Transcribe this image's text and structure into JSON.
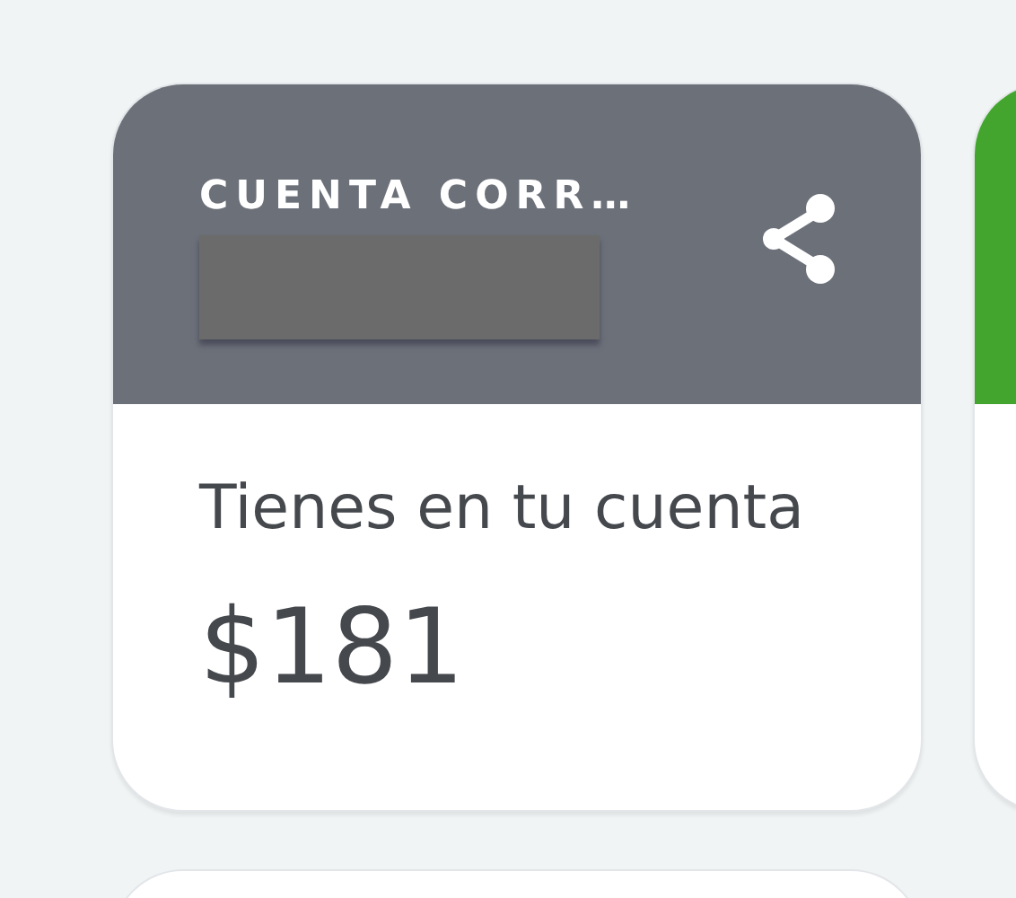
{
  "accounts": [
    {
      "kind": "account",
      "title": "CUENTA CORR…",
      "number_redacted": true,
      "balance_label": "Tienes en tu cuenta",
      "balance": "$181",
      "color": "#6c7079"
    },
    {
      "kind": "account",
      "color": "#43a52e"
    }
  ]
}
